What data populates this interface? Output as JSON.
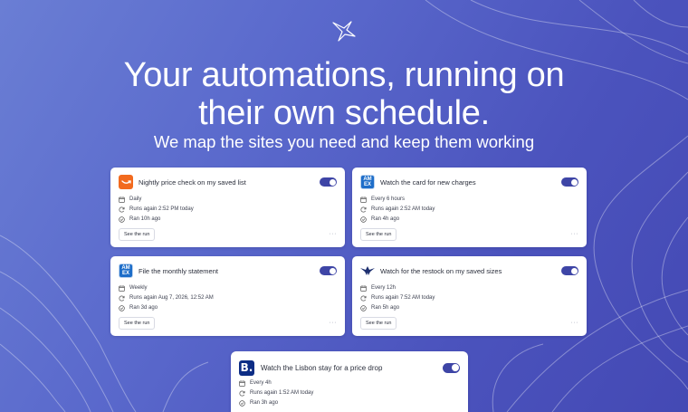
{
  "hero": {
    "headline_line1": "Your automations, running on",
    "headline_line2": "their own schedule.",
    "subheadline": "We map the sites you need and keep them working"
  },
  "colors": {
    "background_start": "#6a7ed4",
    "background_end": "#4449b4",
    "toggle_on": "#3e45a6",
    "card": "#ffffff"
  },
  "cards": [
    {
      "icon": "amazon-smile-icon",
      "title": "Nightly price check on my saved list",
      "enabled": true,
      "frequency": "Daily",
      "next_run": "Runs again 2:52 PM today",
      "last_run": "Ran 10h ago",
      "action_label": "See the run",
      "more_label": "···"
    },
    {
      "icon": "amex-icon",
      "icon_text": "AM EX",
      "title": "Watch the card for new charges",
      "enabled": true,
      "frequency": "Every 6 hours",
      "next_run": "Runs again 2:52 AM today",
      "last_run": "Ran 4h ago",
      "action_label": "See the run",
      "more_label": "···"
    },
    {
      "icon": "amex-icon",
      "icon_text": "AM EX",
      "title": "File the monthly statement",
      "enabled": true,
      "frequency": "Weekly",
      "next_run": "Runs again Aug 7, 2026, 12:52 AM",
      "last_run": "Ran 3d ago",
      "action_label": "See the run",
      "more_label": "···"
    },
    {
      "icon": "bird-logo-icon",
      "title": "Watch for the restock on my saved sizes",
      "enabled": true,
      "frequency": "Every 12h",
      "next_run": "Runs again 7:52 AM today",
      "last_run": "Ran 5h ago",
      "action_label": "See the run",
      "more_label": "···"
    },
    {
      "icon": "booking-icon",
      "icon_text": "B.",
      "title": "Watch the Lisbon stay for a price drop",
      "enabled": true,
      "frequency": "Every 4h",
      "next_run": "Runs again 1:52 AM today",
      "last_run": "Ran 3h ago"
    }
  ]
}
